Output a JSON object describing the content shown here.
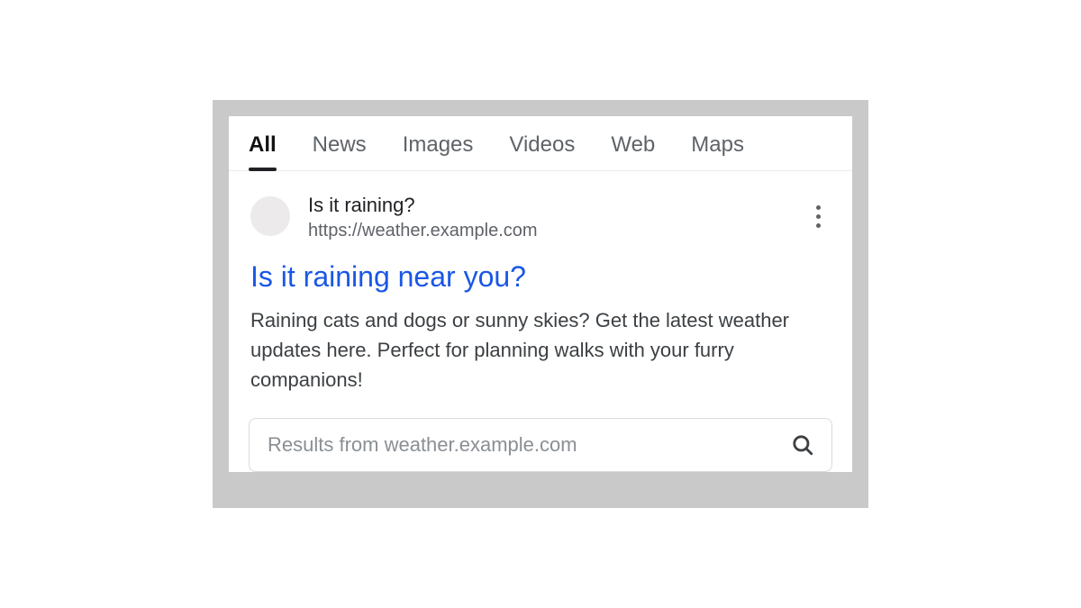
{
  "tabs": {
    "items": [
      "All",
      "News",
      "Images",
      "Videos",
      "Web",
      "Maps"
    ],
    "active_index": 0
  },
  "result": {
    "site_name": "Is it raining?",
    "site_url": "https://weather.example.com",
    "title": "Is it raining near you?",
    "description": "Raining cats and dogs or sunny skies? Get the latest weather updates here. Perfect for planning walks with your furry companions!"
  },
  "site_search": {
    "placeholder": "Results from weather.example.com"
  },
  "icons": {
    "more": "more-vert-icon",
    "search": "search-icon",
    "favicon": "site-favicon"
  },
  "colors": {
    "link": "#1a57e6",
    "muted": "#5f6368",
    "text": "#3c4043",
    "frame": "#c9c9c9"
  }
}
